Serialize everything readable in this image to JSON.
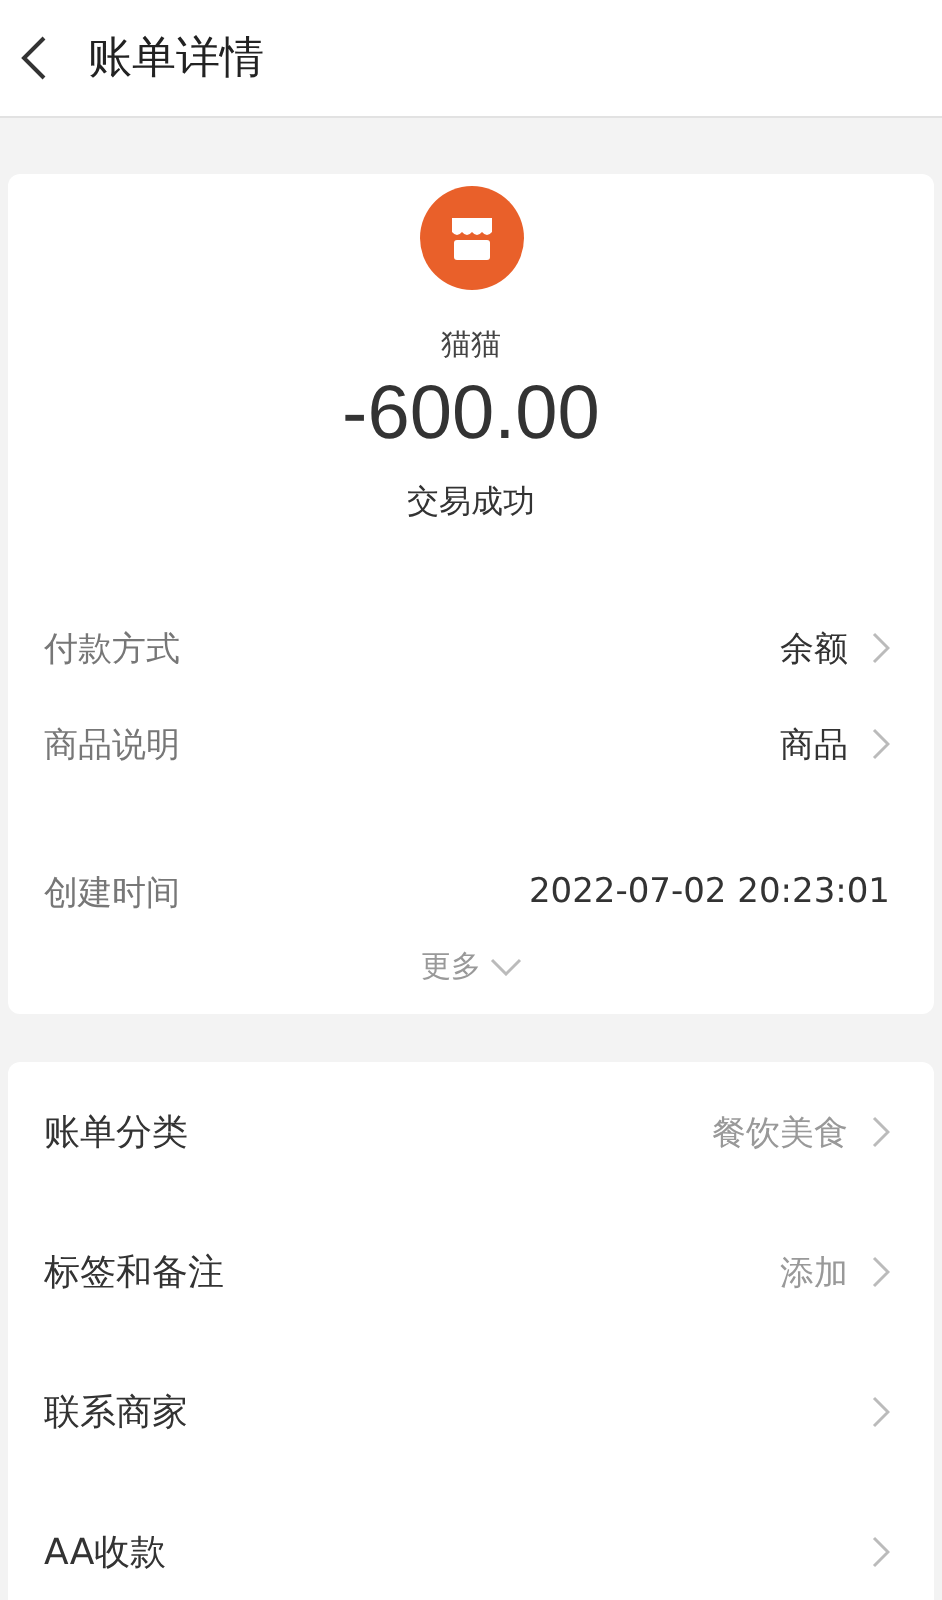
{
  "header": {
    "title": "账单详情"
  },
  "summary": {
    "merchant": "猫猫",
    "amount": "-600.00",
    "status": "交易成功"
  },
  "details": [
    {
      "label": "付款方式",
      "value": "余额",
      "chevron": true
    },
    {
      "label": "商品说明",
      "value": "商品",
      "chevron": true
    },
    {
      "label": "创建时间",
      "value": "2022-07-02 20:23:01",
      "chevron": false
    }
  ],
  "more": "更多",
  "actions": [
    {
      "label": "账单分类",
      "value": "餐饮美食"
    },
    {
      "label": "标签和备注",
      "value": "添加"
    },
    {
      "label": "联系商家"
    },
    {
      "label": "AA收款"
    }
  ]
}
